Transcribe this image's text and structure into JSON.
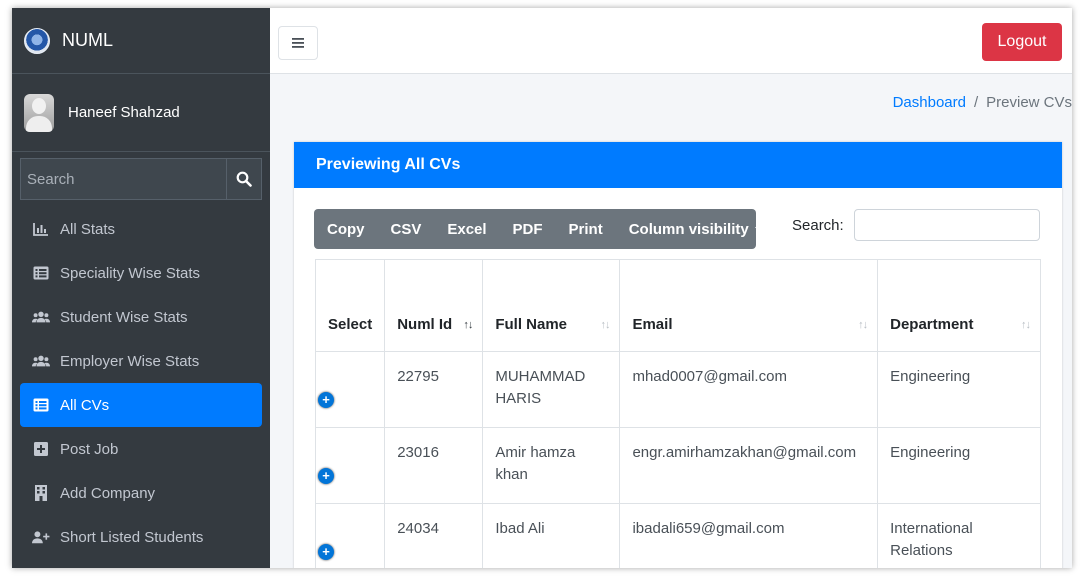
{
  "brand": {
    "name": "NUML"
  },
  "user": {
    "name": "Haneef Shahzad"
  },
  "sidebar": {
    "search_placeholder": "Search",
    "items": [
      {
        "label": "All Stats",
        "icon": "chart-icon"
      },
      {
        "label": "Speciality Wise Stats",
        "icon": "list-icon"
      },
      {
        "label": "Student Wise Stats",
        "icon": "users-icon"
      },
      {
        "label": "Employer Wise Stats",
        "icon": "users-icon"
      },
      {
        "label": "All CVs",
        "icon": "list-icon",
        "active": true
      },
      {
        "label": "Post Job",
        "icon": "plus-square-icon"
      },
      {
        "label": "Add Company",
        "icon": "building-icon"
      },
      {
        "label": "Short Listed Students",
        "icon": "user-plus-icon"
      }
    ]
  },
  "header": {
    "logout_label": "Logout"
  },
  "breadcrumb": {
    "home": "Dashboard",
    "separator": "/",
    "current": "Preview CVs"
  },
  "card": {
    "title": "Previewing All CVs",
    "buttons": [
      "Copy",
      "CSV",
      "Excel",
      "PDF",
      "Print",
      "Column visibility"
    ],
    "search_label": "Search:",
    "columns": [
      "Select",
      "Numl Id",
      "Full Name",
      "Email",
      "Department"
    ],
    "rows": [
      {
        "id": "22795",
        "name": "MUHAMMAD HARIS",
        "email": "mhad0007@gmail.com",
        "department": "Engineering"
      },
      {
        "id": "23016",
        "name": "Amir hamza khan",
        "email": "engr.amirhamzakhan@gmail.com",
        "department": "Engineering"
      },
      {
        "id": "24034",
        "name": "Ibad Ali",
        "email": "ibadali659@gmail.com",
        "department": "International Relations"
      }
    ]
  },
  "colors": {
    "sidebar": "#343a40",
    "accent": "#007bff",
    "logout": "#dc3545",
    "button_group": "#6c757d"
  }
}
